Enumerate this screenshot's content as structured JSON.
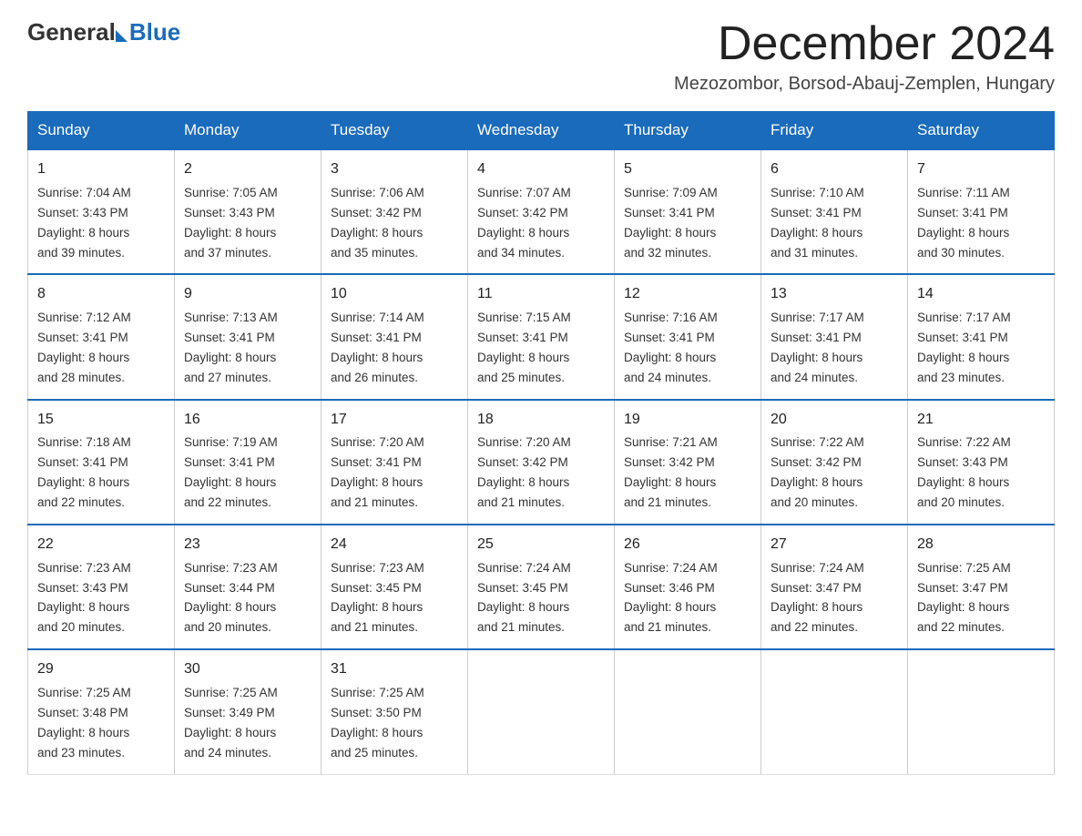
{
  "logo": {
    "general": "General",
    "blue": "Blue"
  },
  "header": {
    "month_title": "December 2024",
    "location": "Mezozombor, Borsod-Abauj-Zemplen, Hungary"
  },
  "weekdays": [
    "Sunday",
    "Monday",
    "Tuesday",
    "Wednesday",
    "Thursday",
    "Friday",
    "Saturday"
  ],
  "weeks": [
    [
      {
        "day": "1",
        "sunrise": "7:04 AM",
        "sunset": "3:43 PM",
        "daylight": "8 hours and 39 minutes."
      },
      {
        "day": "2",
        "sunrise": "7:05 AM",
        "sunset": "3:43 PM",
        "daylight": "8 hours and 37 minutes."
      },
      {
        "day": "3",
        "sunrise": "7:06 AM",
        "sunset": "3:42 PM",
        "daylight": "8 hours and 35 minutes."
      },
      {
        "day": "4",
        "sunrise": "7:07 AM",
        "sunset": "3:42 PM",
        "daylight": "8 hours and 34 minutes."
      },
      {
        "day": "5",
        "sunrise": "7:09 AM",
        "sunset": "3:41 PM",
        "daylight": "8 hours and 32 minutes."
      },
      {
        "day": "6",
        "sunrise": "7:10 AM",
        "sunset": "3:41 PM",
        "daylight": "8 hours and 31 minutes."
      },
      {
        "day": "7",
        "sunrise": "7:11 AM",
        "sunset": "3:41 PM",
        "daylight": "8 hours and 30 minutes."
      }
    ],
    [
      {
        "day": "8",
        "sunrise": "7:12 AM",
        "sunset": "3:41 PM",
        "daylight": "8 hours and 28 minutes."
      },
      {
        "day": "9",
        "sunrise": "7:13 AM",
        "sunset": "3:41 PM",
        "daylight": "8 hours and 27 minutes."
      },
      {
        "day": "10",
        "sunrise": "7:14 AM",
        "sunset": "3:41 PM",
        "daylight": "8 hours and 26 minutes."
      },
      {
        "day": "11",
        "sunrise": "7:15 AM",
        "sunset": "3:41 PM",
        "daylight": "8 hours and 25 minutes."
      },
      {
        "day": "12",
        "sunrise": "7:16 AM",
        "sunset": "3:41 PM",
        "daylight": "8 hours and 24 minutes."
      },
      {
        "day": "13",
        "sunrise": "7:17 AM",
        "sunset": "3:41 PM",
        "daylight": "8 hours and 24 minutes."
      },
      {
        "day": "14",
        "sunrise": "7:17 AM",
        "sunset": "3:41 PM",
        "daylight": "8 hours and 23 minutes."
      }
    ],
    [
      {
        "day": "15",
        "sunrise": "7:18 AM",
        "sunset": "3:41 PM",
        "daylight": "8 hours and 22 minutes."
      },
      {
        "day": "16",
        "sunrise": "7:19 AM",
        "sunset": "3:41 PM",
        "daylight": "8 hours and 22 minutes."
      },
      {
        "day": "17",
        "sunrise": "7:20 AM",
        "sunset": "3:41 PM",
        "daylight": "8 hours and 21 minutes."
      },
      {
        "day": "18",
        "sunrise": "7:20 AM",
        "sunset": "3:42 PM",
        "daylight": "8 hours and 21 minutes."
      },
      {
        "day": "19",
        "sunrise": "7:21 AM",
        "sunset": "3:42 PM",
        "daylight": "8 hours and 21 minutes."
      },
      {
        "day": "20",
        "sunrise": "7:22 AM",
        "sunset": "3:42 PM",
        "daylight": "8 hours and 20 minutes."
      },
      {
        "day": "21",
        "sunrise": "7:22 AM",
        "sunset": "3:43 PM",
        "daylight": "8 hours and 20 minutes."
      }
    ],
    [
      {
        "day": "22",
        "sunrise": "7:23 AM",
        "sunset": "3:43 PM",
        "daylight": "8 hours and 20 minutes."
      },
      {
        "day": "23",
        "sunrise": "7:23 AM",
        "sunset": "3:44 PM",
        "daylight": "8 hours and 20 minutes."
      },
      {
        "day": "24",
        "sunrise": "7:23 AM",
        "sunset": "3:45 PM",
        "daylight": "8 hours and 21 minutes."
      },
      {
        "day": "25",
        "sunrise": "7:24 AM",
        "sunset": "3:45 PM",
        "daylight": "8 hours and 21 minutes."
      },
      {
        "day": "26",
        "sunrise": "7:24 AM",
        "sunset": "3:46 PM",
        "daylight": "8 hours and 21 minutes."
      },
      {
        "day": "27",
        "sunrise": "7:24 AM",
        "sunset": "3:47 PM",
        "daylight": "8 hours and 22 minutes."
      },
      {
        "day": "28",
        "sunrise": "7:25 AM",
        "sunset": "3:47 PM",
        "daylight": "8 hours and 22 minutes."
      }
    ],
    [
      {
        "day": "29",
        "sunrise": "7:25 AM",
        "sunset": "3:48 PM",
        "daylight": "8 hours and 23 minutes."
      },
      {
        "day": "30",
        "sunrise": "7:25 AM",
        "sunset": "3:49 PM",
        "daylight": "8 hours and 24 minutes."
      },
      {
        "day": "31",
        "sunrise": "7:25 AM",
        "sunset": "3:50 PM",
        "daylight": "8 hours and 25 minutes."
      },
      null,
      null,
      null,
      null
    ]
  ],
  "labels": {
    "sunrise": "Sunrise:",
    "sunset": "Sunset:",
    "daylight": "Daylight:"
  }
}
